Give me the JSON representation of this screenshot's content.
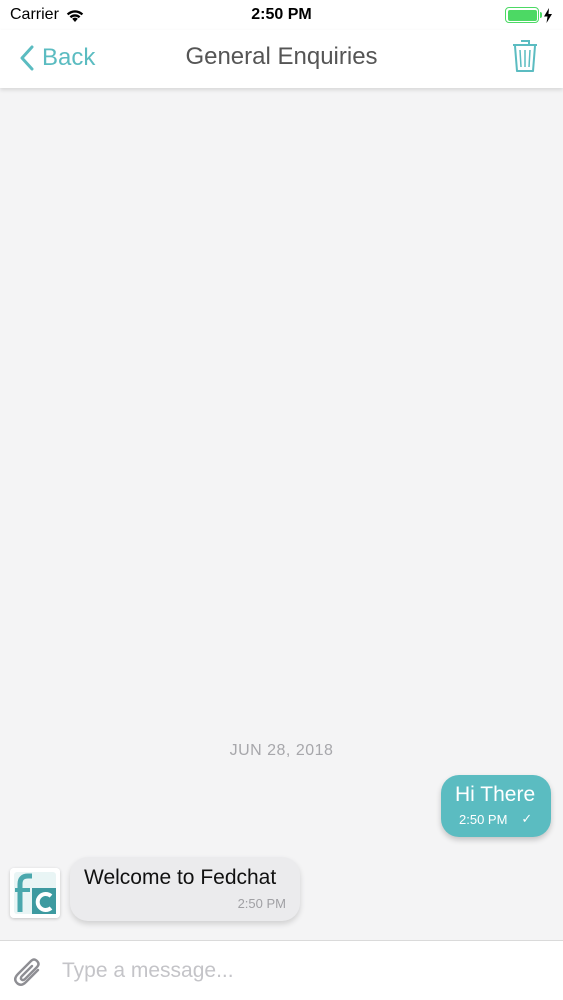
{
  "status_bar": {
    "carrier": "Carrier",
    "time": "2:50 PM"
  },
  "nav": {
    "back_label": "Back",
    "title": "General Enquiries"
  },
  "chat": {
    "date_separator": "JUN 28, 2018",
    "messages": [
      {
        "direction": "outgoing",
        "text": "Hi There",
        "time": "2:50 PM",
        "status": "✓"
      },
      {
        "direction": "incoming",
        "text": "Welcome to Fedchat",
        "time": "2:50 PM"
      }
    ]
  },
  "composer": {
    "placeholder": "Type a message..."
  },
  "colors": {
    "accent": "#5bbcc1",
    "battery": "#4cd964",
    "background": "#f4f4f5",
    "incoming_bubble": "#ebebed"
  },
  "icons": [
    "wifi-icon",
    "battery-icon",
    "charging-bolt-icon",
    "chevron-left-icon",
    "trash-icon",
    "fedchat-logo",
    "paperclip-icon"
  ]
}
